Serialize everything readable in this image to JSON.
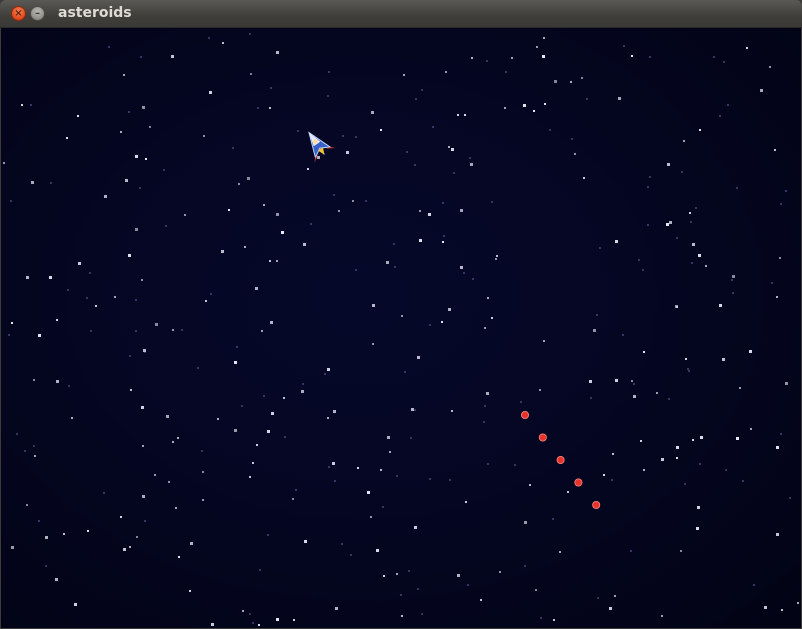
{
  "window": {
    "title": "asteroids",
    "close_icon": "close-icon",
    "minimize_icon": "minimize-icon"
  },
  "game": {
    "background_color": "#040620",
    "star_color": "#e6e8f5",
    "dim_star_color": "#3a3466",
    "bullet_color": "#e8322c",
    "ship_icon": "spaceship-icon",
    "bullet_count": 5
  }
}
